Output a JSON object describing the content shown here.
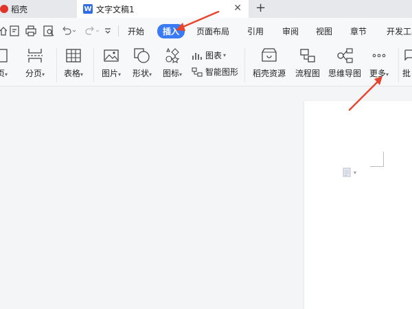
{
  "tabs": [
    {
      "title": "稻壳",
      "active": false
    },
    {
      "title": "文字文稿1",
      "active": true
    }
  ],
  "tab_icon_letter": "W",
  "menu": {
    "items": [
      "开始",
      "插入",
      "页面布局",
      "引用",
      "审阅",
      "视图",
      "章节",
      "开发工具"
    ],
    "selected": "插入"
  },
  "ribbon": {
    "page_label": "页",
    "section_break_label": "分页",
    "table_label": "表格",
    "picture_label": "图片",
    "shape_label": "形状",
    "icon_label": "图标",
    "chart_label": "图表",
    "smartart_label": "智能图形",
    "docer_label": "稻壳资源",
    "flowchart_label": "流程图",
    "mindmap_label": "思维导图",
    "more_label": "更多",
    "partial_label": "批"
  },
  "colors": {
    "accent": "#3a7af5",
    "arrow": "#e8442c",
    "logo": "#e0352b",
    "wps_blue": "#2f6ee8"
  }
}
